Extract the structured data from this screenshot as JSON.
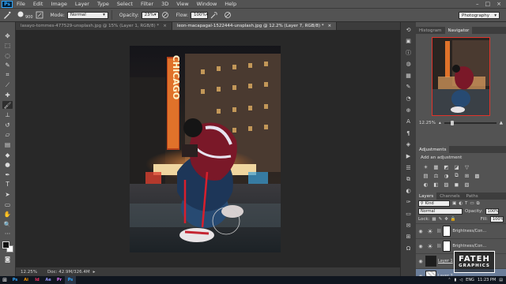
{
  "app": {
    "logo_text": "Ps"
  },
  "menu": [
    "File",
    "Edit",
    "Image",
    "Layer",
    "Type",
    "Select",
    "Filter",
    "3D",
    "View",
    "Window",
    "Help"
  ],
  "window_controls": {
    "minimize": "–",
    "maximize": "□",
    "close": "×"
  },
  "options": {
    "brush_size": "900",
    "mode_label": "Mode:",
    "mode_value": "Normal",
    "opacity_label": "Opacity:",
    "opacity_value": "23%",
    "flow_label": "Flow:",
    "flow_value": "100%",
    "workspace": "Photography"
  },
  "tabs": [
    {
      "label": "lasayo-tommes-477529-unsplash.jpg @ 15% (Layer 1, RGB/8) *",
      "close": "×"
    },
    {
      "label": "leon-macapagal-1522444-unsplash.jpg @ 12.2% (Layer 7, RGB/8) *",
      "close": "×"
    }
  ],
  "photo": {
    "sign_text": "CHICAGO"
  },
  "status": {
    "zoom": "12.25%",
    "doc_size": "Doc: 42.9M/326.4M"
  },
  "navigator": {
    "tabs": [
      "Histogram",
      "Navigator"
    ],
    "zoom": "12.25%"
  },
  "adjustments": {
    "tabs": [
      "Adjustments"
    ],
    "add_label": "Add an adjustment",
    "row1": [
      "☀",
      "▦",
      "◩",
      "◪",
      "▽"
    ],
    "row2": [
      "▤",
      "⚖",
      "◑",
      "⧉",
      "⊞",
      "▩"
    ],
    "row3": [
      "◐",
      "◧",
      "▨",
      "◼",
      "▧"
    ]
  },
  "layers": {
    "tabs": [
      "Layers",
      "Channels",
      "Paths"
    ],
    "kind": "Kind",
    "blend": "Normal",
    "opacity_label": "Opacity:",
    "opacity_value": "100%",
    "lock_label": "Lock:",
    "fill_label": "Fill:",
    "fill_value": "100%",
    "rows": [
      {
        "name": "Brightness/Con..."
      },
      {
        "name": "Brightness/Con..."
      },
      {
        "name": "Layer 1"
      },
      {
        "name": "Layer 7"
      }
    ]
  },
  "watermark": {
    "line1": "FATEH",
    "line2": "GRAPHICS"
  },
  "taskbar": {
    "apps": [
      "Ps",
      "Ai",
      "Id",
      "Ae",
      "Pr",
      "Ps"
    ],
    "lang": "ENG",
    "time": "11:23 PM"
  }
}
